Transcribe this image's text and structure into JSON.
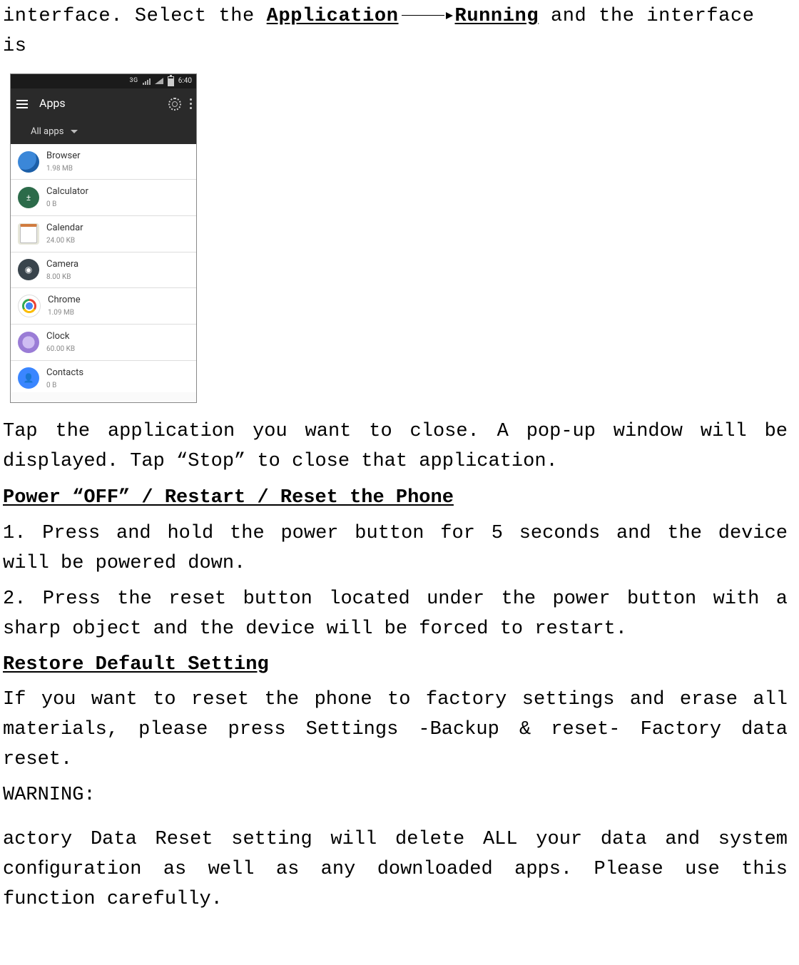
{
  "intro": {
    "prefix": "interface. Select the ",
    "app_word": "Application",
    "running_word": "Running",
    "suffix": " and the interface is"
  },
  "screenshot": {
    "status": {
      "network": "3G",
      "clock": "6:40"
    },
    "appbar_title": "Apps",
    "filter_label": "All apps",
    "apps": [
      {
        "name": "Browser",
        "size": "1.98 MB",
        "icon": "browser"
      },
      {
        "name": "Calculator",
        "size": "0 B",
        "icon": "calc"
      },
      {
        "name": "Calendar",
        "size": "24.00 KB",
        "icon": "calendar"
      },
      {
        "name": "Camera",
        "size": "8.00 KB",
        "icon": "camera"
      },
      {
        "name": "Chrome",
        "size": "1.09 MB",
        "icon": "chrome"
      },
      {
        "name": "Clock",
        "size": "60.00 KB",
        "icon": "clock"
      },
      {
        "name": "Contacts",
        "size": "0 B",
        "icon": "contacts"
      }
    ]
  },
  "tap_para": "Tap the application you want to close. A pop-up window will be displayed. Tap “Stop” to close that application.",
  "heading_power": "Power “OFF” / Restart / Reset the Phone",
  "power_item1": "1.  Press and hold the power button for 5 seconds and the device will be powered down.",
  "power_item2": "2. Press the reset button located under the power button with a sharp object and the device will be forced to restart.",
  "heading_restore": "Restore Default Setting",
  "restore_para": "If you want to reset the phone to factory settings and erase all materials, please press Settings -Backup & reset- Factory data reset.",
  "warning_label": "WARNING:",
  "warning_para": "actory Data Reset setting will delete ALL your data and system conﬁguration as well as any downloaded apps. Please use this function carefully."
}
